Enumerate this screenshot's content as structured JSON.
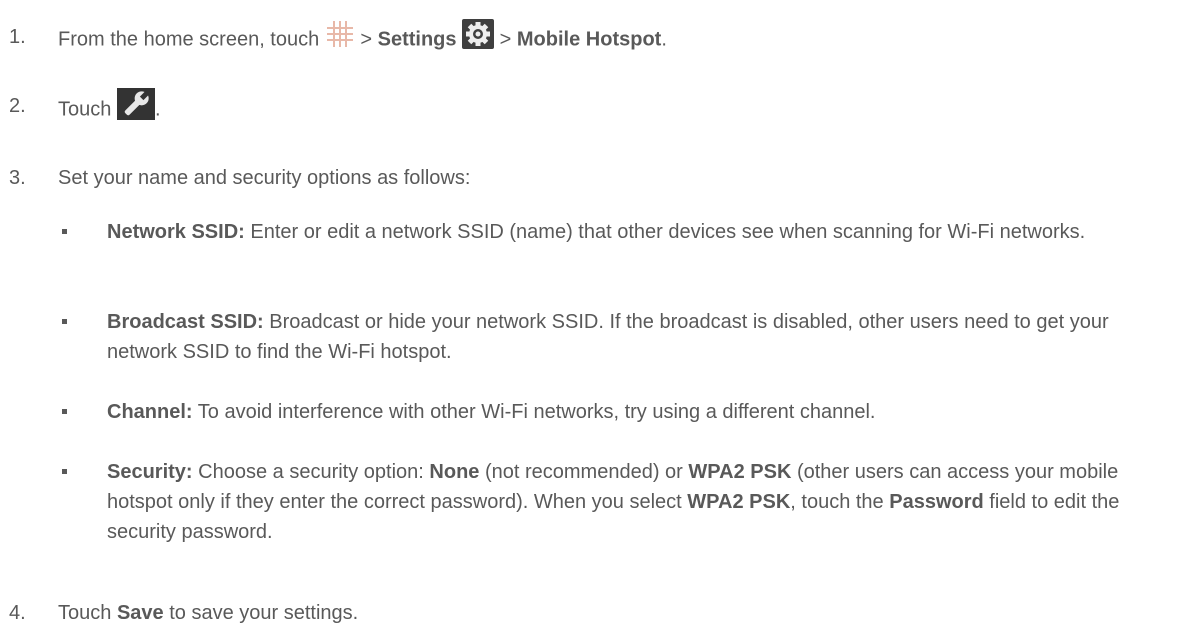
{
  "steps": [
    {
      "number": "1.",
      "prefix": "From the home screen, touch",
      "sep1": ">",
      "settings": "Settings",
      "sep2": ">",
      "hotspot": "Mobile Hotspot",
      "end": "."
    },
    {
      "number": "2.",
      "prefix": "Touch",
      "end": "."
    },
    {
      "number": "3.",
      "text": "Set your name and security options as follows:"
    },
    {
      "number": "4.",
      "prefix": "Touch",
      "save": "Save",
      "suffix": "to save your settings."
    }
  ],
  "options": [
    {
      "label": "Network SSID:",
      "text": "Enter or edit a network SSID (name) that other devices see when scanning for Wi-Fi networks."
    },
    {
      "label": "Broadcast SSID:",
      "text": "Broadcast or hide your network SSID. If the broadcast is disabled, other users need to get your network SSID to find the Wi-Fi hotspot."
    },
    {
      "label": "Channel:",
      "text": "To avoid interference with other Wi-Fi networks, try using a different channel."
    },
    {
      "label": "Security:",
      "t1": "Choose a security option:",
      "none": "None",
      "t2": "(not recommended) or",
      "wpa": "WPA2 PSK",
      "t3": "(other users can access your mobile hotspot only if they enter the correct password). When you select",
      "wpa2": "WPA2 PSK",
      "t4": ", touch the",
      "password": "Password",
      "t5": "field to edit the security password."
    }
  ],
  "icons": {
    "apps": "apps-grid-icon",
    "settings": "settings-gear-icon",
    "wrench": "wrench-icon"
  }
}
